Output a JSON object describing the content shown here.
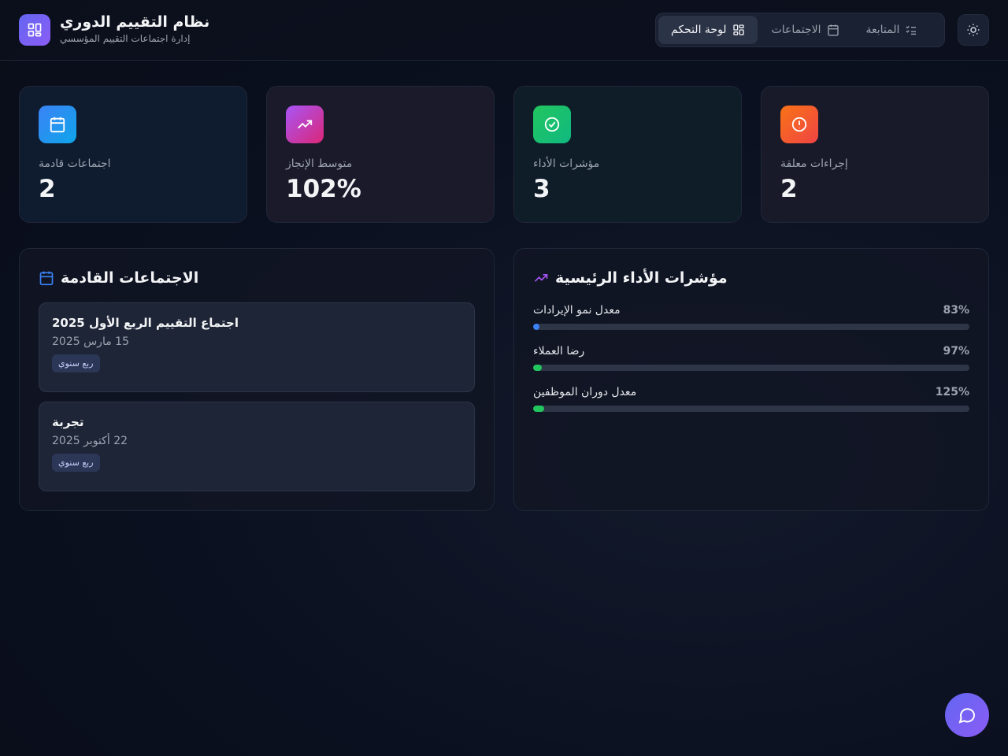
{
  "header": {
    "title": "نظام التقييم الدوري",
    "subtitle": "إدارة اجتماعات التقييم المؤسسي",
    "logo_icon": "grid-icon",
    "theme_icon": "sun-icon"
  },
  "nav": {
    "items": [
      {
        "label": "المتابعة",
        "icon": "checklist-icon"
      },
      {
        "label": "الاجتماعات",
        "icon": "calendar-icon"
      },
      {
        "label": "لوحة التحكم",
        "icon": "dashboard-icon",
        "active": true
      }
    ]
  },
  "stats": [
    {
      "label": "إجراءات معلقة",
      "value": "2",
      "icon": "alert-icon",
      "color": "#f97316"
    },
    {
      "label": "مؤشرات الأداء",
      "value": "3",
      "icon": "check-circle-icon",
      "color": "#22c55e"
    },
    {
      "label": "متوسط الإنجاز",
      "value": "102%",
      "icon": "trending-up-icon",
      "color": "#c026d3"
    },
    {
      "label": "اجتماعات قادمة",
      "value": "2",
      "icon": "calendar-icon",
      "color": "#3b82f6"
    }
  ],
  "kpi_panel": {
    "title": "مؤشرات الأداء الرئيسية",
    "icon": "trending-up-icon",
    "items": [
      {
        "name": "معدل نمو الإيرادات",
        "value": "83%",
        "fill": 0.015,
        "color": "#3b82f6"
      },
      {
        "name": "رضا العملاء",
        "value": "97%",
        "fill": 0.02,
        "color": "#22c55e"
      },
      {
        "name": "معدل دوران الموظفين",
        "value": "125%",
        "fill": 0.025,
        "color": "#22c55e"
      }
    ]
  },
  "meetings_panel": {
    "title": "الاجتماعات القادمة",
    "icon": "calendar-icon",
    "items": [
      {
        "title": "اجتماع التقييم الربع الأول 2025",
        "date": "15 مارس 2025",
        "badge": "ربع سنوي"
      },
      {
        "title": "تجربة",
        "date": "22 أكتوبر 2025",
        "badge": "ربع سنوي"
      }
    ]
  },
  "chat": {
    "icon": "chat-icon"
  }
}
